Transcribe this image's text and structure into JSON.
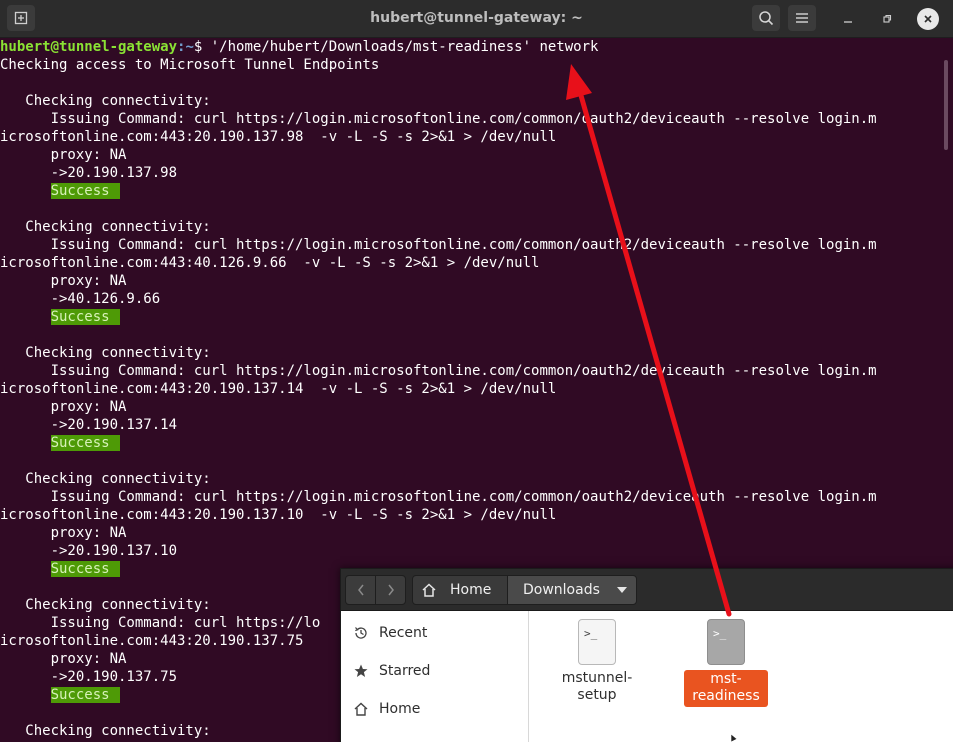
{
  "window": {
    "title": "hubert@tunnel-gateway: ~"
  },
  "terminal": {
    "prompt_user": "hubert@tunnel-gateway",
    "prompt_sep": ":~$ ",
    "command": "'/home/hubert/Downloads/mst-readiness' network",
    "header_line": "Checking access to Microsoft Tunnel Endpoints",
    "checks": [
      {
        "heading": "   Checking connectivity:",
        "cmd1": "      Issuing Command: curl https://login.microsoftonline.com/common/oauth2/deviceauth --resolve login.m",
        "cmd2": "icrosoftonline.com:443:20.190.137.98  -v -L -S -s 2>&1 > /dev/null",
        "proxy": "      proxy: NA",
        "ip": "      ->20.190.137.98",
        "result": "Success"
      },
      {
        "heading": "   Checking connectivity:",
        "cmd1": "      Issuing Command: curl https://login.microsoftonline.com/common/oauth2/deviceauth --resolve login.m",
        "cmd2": "icrosoftonline.com:443:40.126.9.66  -v -L -S -s 2>&1 > /dev/null",
        "proxy": "      proxy: NA",
        "ip": "      ->40.126.9.66",
        "result": "Success"
      },
      {
        "heading": "   Checking connectivity:",
        "cmd1": "      Issuing Command: curl https://login.microsoftonline.com/common/oauth2/deviceauth --resolve login.m",
        "cmd2": "icrosoftonline.com:443:20.190.137.14  -v -L -S -s 2>&1 > /dev/null",
        "proxy": "      proxy: NA",
        "ip": "      ->20.190.137.14",
        "result": "Success"
      },
      {
        "heading": "   Checking connectivity:",
        "cmd1": "      Issuing Command: curl https://login.microsoftonline.com/common/oauth2/deviceauth --resolve login.m",
        "cmd2": "icrosoftonline.com:443:20.190.137.10  -v -L -S -s 2>&1 > /dev/null",
        "proxy": "      proxy: NA",
        "ip": "      ->20.190.137.10",
        "result": "Success"
      },
      {
        "heading": "   Checking connectivity:",
        "cmd1": "      Issuing Command: curl https://lo",
        "cmd2": "icrosoftonline.com:443:20.190.137.75",
        "proxy": "      proxy: NA",
        "ip": "      ->20.190.137.75",
        "result": "Success"
      }
    ],
    "tail_heading": "   Checking connectivity:"
  },
  "files": {
    "path": [
      "Home",
      "Downloads"
    ],
    "sidebar": [
      "Recent",
      "Starred",
      "Home"
    ],
    "items": [
      {
        "name": "mstunnel-\nsetup",
        "line1": "mstunnel-",
        "line2": "setup",
        "selected": false
      },
      {
        "name": "mst-readiness",
        "line1": "mst-",
        "line2": "readiness",
        "selected": true
      }
    ]
  },
  "icons": {
    "terminal_glyph": ">_"
  },
  "colors": {
    "terminal_bg": "#300a24",
    "prompt_user": "#8ae234",
    "prompt_path": "#729fcf",
    "success_bg": "#4e9a06",
    "selection": "#e95420",
    "annotation_arrow": "#e8101a"
  }
}
